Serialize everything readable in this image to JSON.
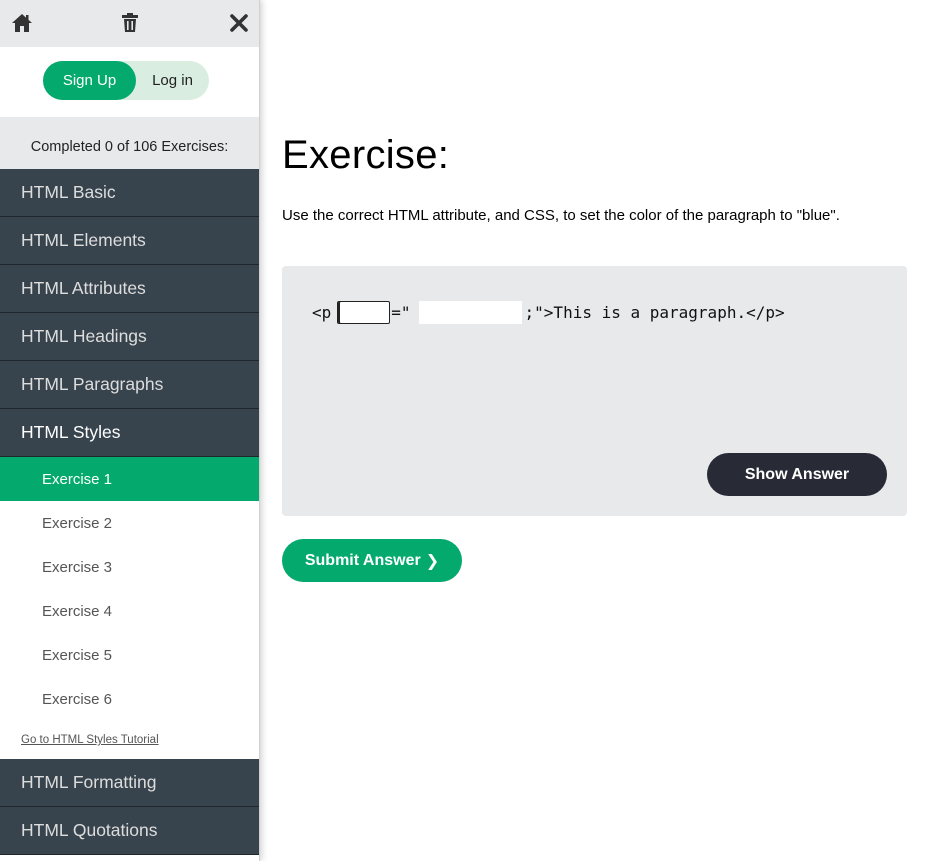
{
  "sidebar": {
    "topbar": {
      "home_icon": "home-icon",
      "trash_icon": "trash-icon",
      "close_icon": "close-icon"
    },
    "auth": {
      "signup_label": "Sign Up",
      "login_label": "Log in"
    },
    "progress_text": "Completed 0 of 106 Exercises:",
    "nav_top": [
      {
        "label": "HTML Basic"
      },
      {
        "label": "HTML Elements"
      },
      {
        "label": "HTML Attributes"
      },
      {
        "label": "HTML Headings"
      },
      {
        "label": "HTML Paragraphs"
      },
      {
        "label": "HTML Styles"
      }
    ],
    "exercises": [
      {
        "label": "Exercise 1"
      },
      {
        "label": "Exercise 2"
      },
      {
        "label": "Exercise 3"
      },
      {
        "label": "Exercise 4"
      },
      {
        "label": "Exercise 5"
      },
      {
        "label": "Exercise 6"
      }
    ],
    "tutorial_link": "Go to HTML Styles Tutorial",
    "nav_bottom": [
      {
        "label": "HTML Formatting"
      },
      {
        "label": "HTML Quotations"
      }
    ]
  },
  "main": {
    "title": "Exercise:",
    "instructions": "Use the correct HTML attribute, and CSS, to set the color of the paragraph to \"blue\".",
    "code": {
      "part1": "<p",
      "part2": "=\"",
      "part3": ";\">This is a paragraph.</p>",
      "input1_value": "",
      "input2_value": ""
    },
    "show_answer_label": "Show Answer",
    "submit_label": "Submit Answer",
    "submit_chevron": "❯"
  },
  "colors": {
    "accent": "#04aa6d",
    "sidebar_nav": "#38444d",
    "dark_button": "#282a35",
    "code_bg": "#e7e9eb"
  }
}
